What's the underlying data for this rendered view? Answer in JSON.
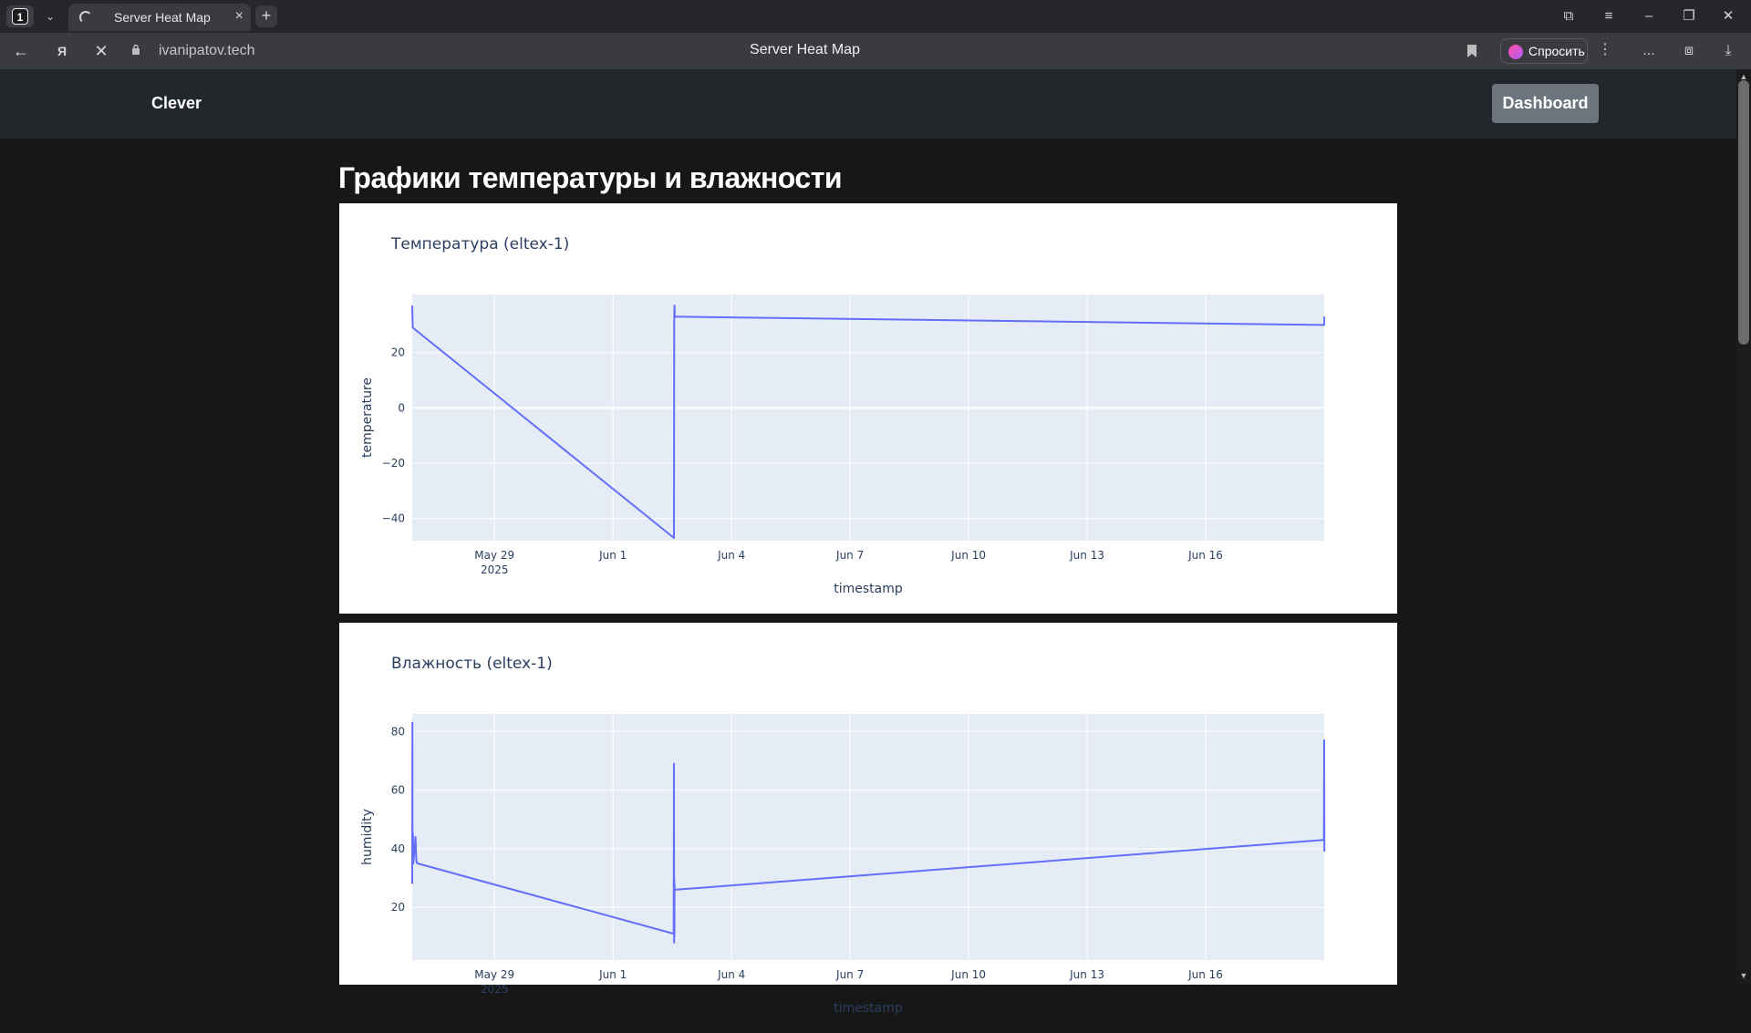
{
  "browser": {
    "tab_count": "1",
    "tab_title": "Server Heat Map",
    "url": "ivanipatov.tech",
    "page_title": "Server Heat Map",
    "ask_label": "Спросить",
    "more_label": "...",
    "icons": [
      "tab-dropdown-icon",
      "spinner-icon",
      "close-icon",
      "plus-icon",
      "collections-icon",
      "menu-icon",
      "minimize-icon",
      "restore-icon",
      "window-close-icon",
      "back-icon",
      "yandex-icon",
      "stop-icon",
      "lock-icon",
      "bookmark-icon",
      "kebab-icon",
      "extensions-icon",
      "screenshot-icon",
      "download-icon"
    ]
  },
  "site": {
    "brand": "Clever",
    "dashboard_label": "Dashboard",
    "heading": "Графики температуры и влажности"
  },
  "colors": {
    "plot_bg": "#e5ecf6",
    "line": "#636efa",
    "nav_bg": "#23272b",
    "page_bg": "#171717",
    "button_bg": "#6c757d"
  },
  "chart_data": [
    {
      "type": "line",
      "title": "Температура (eltex-1)",
      "xlabel": "timestamp",
      "ylabel": "temperature",
      "x_ticks": [
        "May 29\n2025",
        "Jun 1",
        "Jun 4",
        "Jun 7",
        "Jun 10",
        "Jun 13",
        "Jun 16"
      ],
      "y_ticks": [
        "20",
        "0",
        "−20",
        "−40"
      ],
      "ylim": [
        -48,
        41
      ],
      "xlim": [
        "2025-05-26T22:00",
        "2025-06-19T00:00"
      ],
      "series": [
        {
          "x": [
            "2025-05-26T22:00",
            "2025-05-26T22:10",
            "2025-05-26T22:20",
            "2025-06-02T13:00",
            "2025-06-02T13:10",
            "2025-06-02T13:20",
            "2025-06-02T13:30",
            "2025-06-19T00:00",
            "2025-06-19T00:05"
          ],
          "y": [
            37,
            33,
            29,
            -47,
            33,
            37,
            33,
            30,
            33
          ]
        }
      ],
      "grid": true
    },
    {
      "type": "line",
      "title": "Влажность (eltex-1)",
      "xlabel": "timestamp",
      "ylabel": "humidity",
      "x_ticks": [
        "May 29\n2025",
        "Jun 1",
        "Jun 4",
        "Jun 7",
        "Jun 10",
        "Jun 13",
        "Jun 16"
      ],
      "y_ticks": [
        "80",
        "60",
        "40",
        "20"
      ],
      "ylim": [
        2,
        86
      ],
      "xlim": [
        "2025-05-26T22:00",
        "2025-06-19T00:00"
      ],
      "series": [
        {
          "x": [
            "2025-05-26T22:00",
            "2025-05-26T22:05",
            "2025-05-26T22:10",
            "2025-05-26T22:20",
            "2025-05-26T22:30",
            "2025-05-26T22:40",
            "2025-05-26T23:00",
            "2025-05-27T00:00",
            "2025-05-27T00:30",
            "2025-05-27T01:00",
            "2025-06-02T12:50",
            "2025-06-02T13:00",
            "2025-06-02T13:05",
            "2025-06-02T13:10",
            "2025-06-02T13:15",
            "2025-06-02T13:20",
            "2025-06-02T13:30",
            "2025-06-18T23:50",
            "2025-06-19T00:00",
            "2025-06-19T00:05"
          ],
          "y": [
            28,
            83,
            40,
            35,
            45,
            35,
            37,
            44,
            36,
            35,
            11,
            69,
            8,
            30,
            10,
            28,
            26,
            43,
            77,
            39
          ]
        }
      ],
      "grid": true
    }
  ]
}
